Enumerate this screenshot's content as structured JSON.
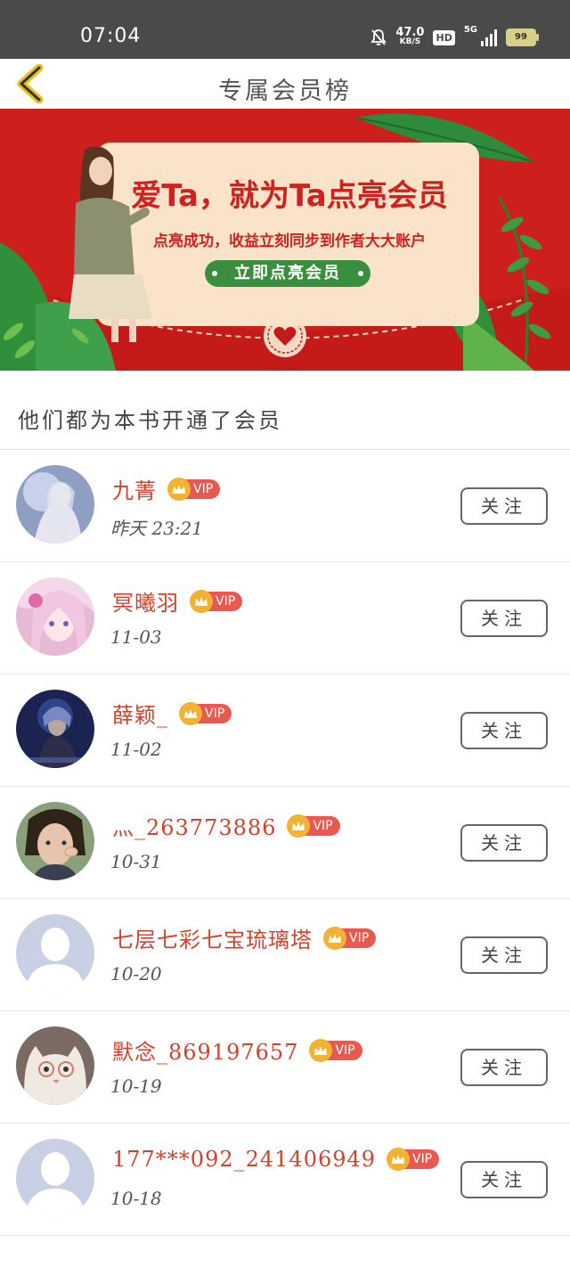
{
  "status_bar": {
    "time": "07:04",
    "net_speed_value": "47.0",
    "net_speed_unit": "KB/S",
    "hd": "HD",
    "network": "5G",
    "battery": "99"
  },
  "header": {
    "title": "专属会员榜"
  },
  "banner": {
    "headline": "爱Ta，就为Ta点亮会员",
    "subline": "点亮成功，收益立刻同步到作者大大账户",
    "button_label": "立即点亮会员"
  },
  "section": {
    "title": "他们都为本书开通了会员"
  },
  "vip_label": "VIP",
  "follow_label": "关注",
  "members": [
    {
      "name": "九菁",
      "date": "昨天 23:21",
      "avatar": "anime-girl-avatar"
    },
    {
      "name": "冥曦羽",
      "date": "11-03",
      "avatar": "anime-pink-hair-avatar"
    },
    {
      "name": "薛颖_",
      "date": "11-02",
      "avatar": "game-character-avatar"
    },
    {
      "name": "灬_263773886",
      "date": "10-31",
      "avatar": "selfie-photo-avatar"
    },
    {
      "name": "七层七彩七宝琉璃塔",
      "date": "10-20",
      "avatar": "default-person-avatar"
    },
    {
      "name": "默念_869197657",
      "date": "10-19",
      "avatar": "cat-with-glasses-avatar"
    },
    {
      "name": "177***092_241406949",
      "date": "10-18",
      "avatar": "default-person-avatar"
    }
  ],
  "colors": {
    "accent_red": "#d4422d",
    "banner_red": "#cd1f1d",
    "vip_badge": "#e85a4f",
    "crown_gold": "#f2b233",
    "status_bar": "#4a4a4a"
  }
}
